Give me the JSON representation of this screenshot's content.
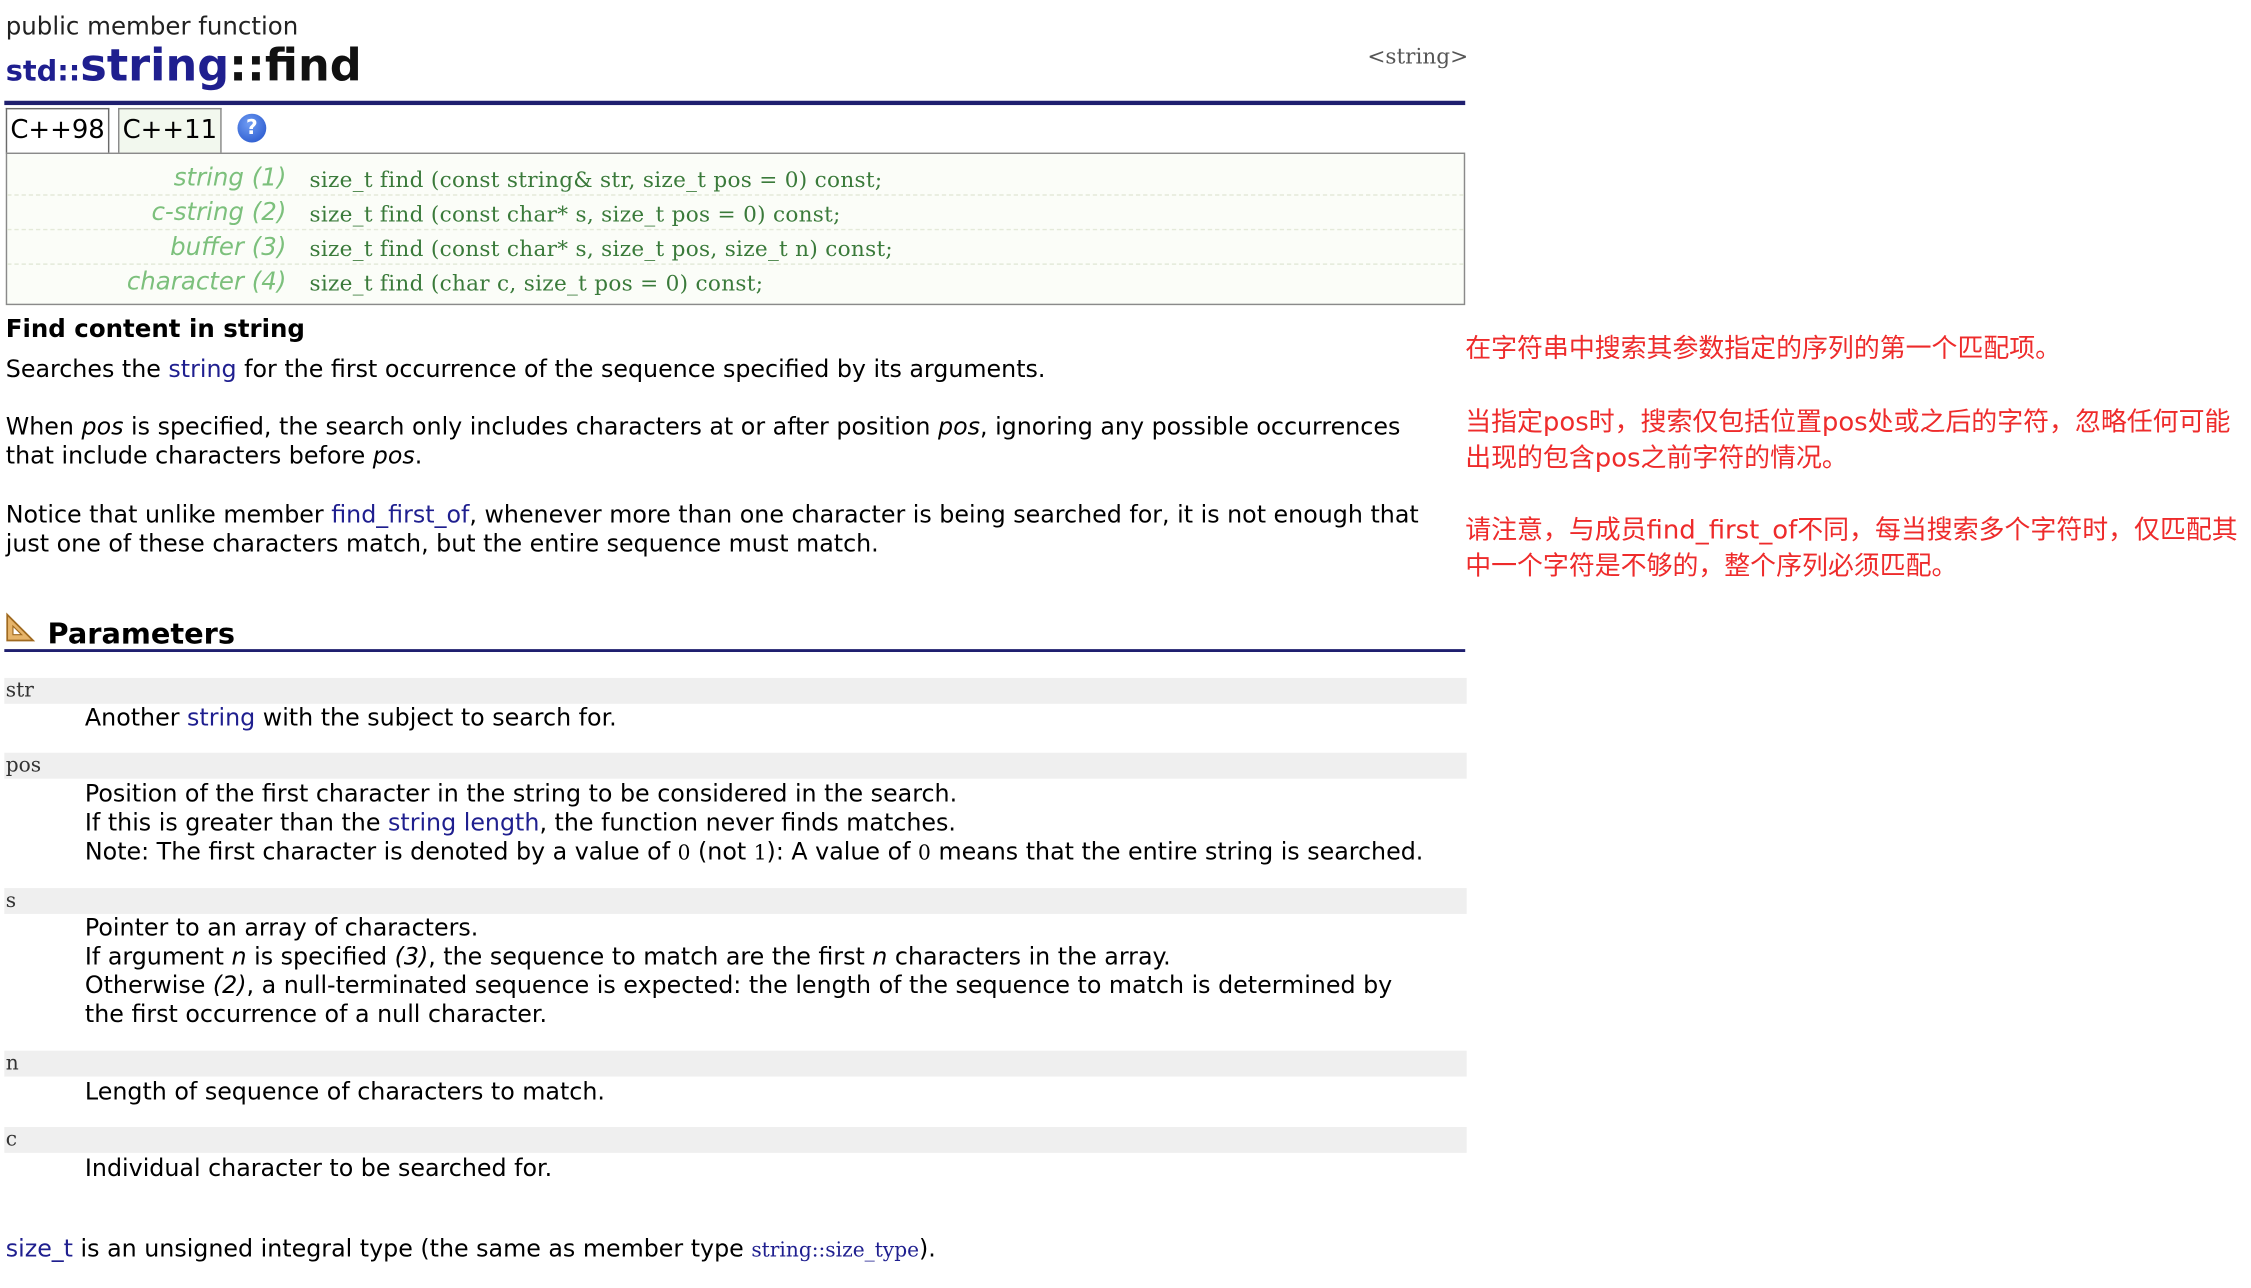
{
  "header": {
    "kind": "public member function",
    "ns": "std::",
    "class_name": "string",
    "sep": "::",
    "fn_name": "find",
    "header_ref": "<string>"
  },
  "tabs": [
    {
      "label": "C++98",
      "active": true
    },
    {
      "label": "C++11",
      "active": false
    }
  ],
  "help_icon": "?",
  "prototypes": [
    {
      "label": "string (1)",
      "code": "size_t find (const string& str, size_t pos = 0) const;"
    },
    {
      "label": "c-string (2)",
      "code": "size_t find (const char* s, size_t pos = 0) const;"
    },
    {
      "label": "buffer (3)",
      "code": "size_t find (const char* s, size_t pos, size_t n) const;"
    },
    {
      "label": "character (4)",
      "code": "size_t find (char c, size_t pos = 0) const;"
    }
  ],
  "description": {
    "heading": "Find content in string",
    "p1": {
      "a": "Searches the ",
      "link": "string",
      "b": " for the first occurrence of the sequence specified by its arguments."
    },
    "p2": {
      "a": "When ",
      "i1": "pos",
      "b": " is specified, the search only includes characters at or after position ",
      "i2": "pos",
      "c": ", ignoring any possible occurrences that include characters before ",
      "i3": "pos",
      "d": "."
    },
    "p3": {
      "a": "Notice that unlike member ",
      "link": "find_first_of",
      "b": ", whenever more than one character is being searched for, it is not enough that just one of these characters match, but the entire sequence must match."
    }
  },
  "notes": [
    "在字符串中搜索其参数指定的序列的第一个匹配项。",
    "当指定pos时，搜索仅包括位置pos处或之后的字符，忽略任何可能出现的包含pos之前字符的情况。",
    "请注意，与成员find_first_of不同，每当搜索多个字符时，仅匹配其中一个字符是不够的，整个序列必须匹配。"
  ],
  "params": {
    "heading": "Parameters",
    "str": {
      "name": "str",
      "a": "Another ",
      "link": "string",
      "b": " with the subject to search for."
    },
    "pos": {
      "name": "pos",
      "l1": "Position of the first character in the string to be considered in the search.",
      "l2a": "If this is greater than the ",
      "l2link": "string length",
      "l2b": ", the function never finds matches.",
      "l3a": "Note: The first character is denoted by a value of ",
      "l3v0": "0",
      "l3b": " (not ",
      "l3v1": "1",
      "l3c": "): A value of ",
      "l3v2": "0",
      "l3d": " means that the entire string is searched."
    },
    "s": {
      "name": "s",
      "l1": "Pointer to an array of characters.",
      "l2a": "If argument ",
      "l2i": "n",
      "l2b": " is specified ",
      "l2ref": "(3)",
      "l2c": ", the sequence to match are the first ",
      "l2i2": "n",
      "l2d": " characters in the array.",
      "l3a": "Otherwise ",
      "l3ref": "(2)",
      "l3b": ", a null-terminated sequence is expected: the length of the sequence to match is determined by",
      "l4": "the first occurrence of a null character."
    },
    "n": {
      "name": "n",
      "l1": "Length of sequence of characters to match."
    },
    "c": {
      "name": "c",
      "l1": "Individual character to be searched for."
    }
  },
  "footer": {
    "link": "size_t",
    "a": " is an unsigned integral type (the same as member type ",
    "code": "string::size_type",
    "b": ")."
  }
}
